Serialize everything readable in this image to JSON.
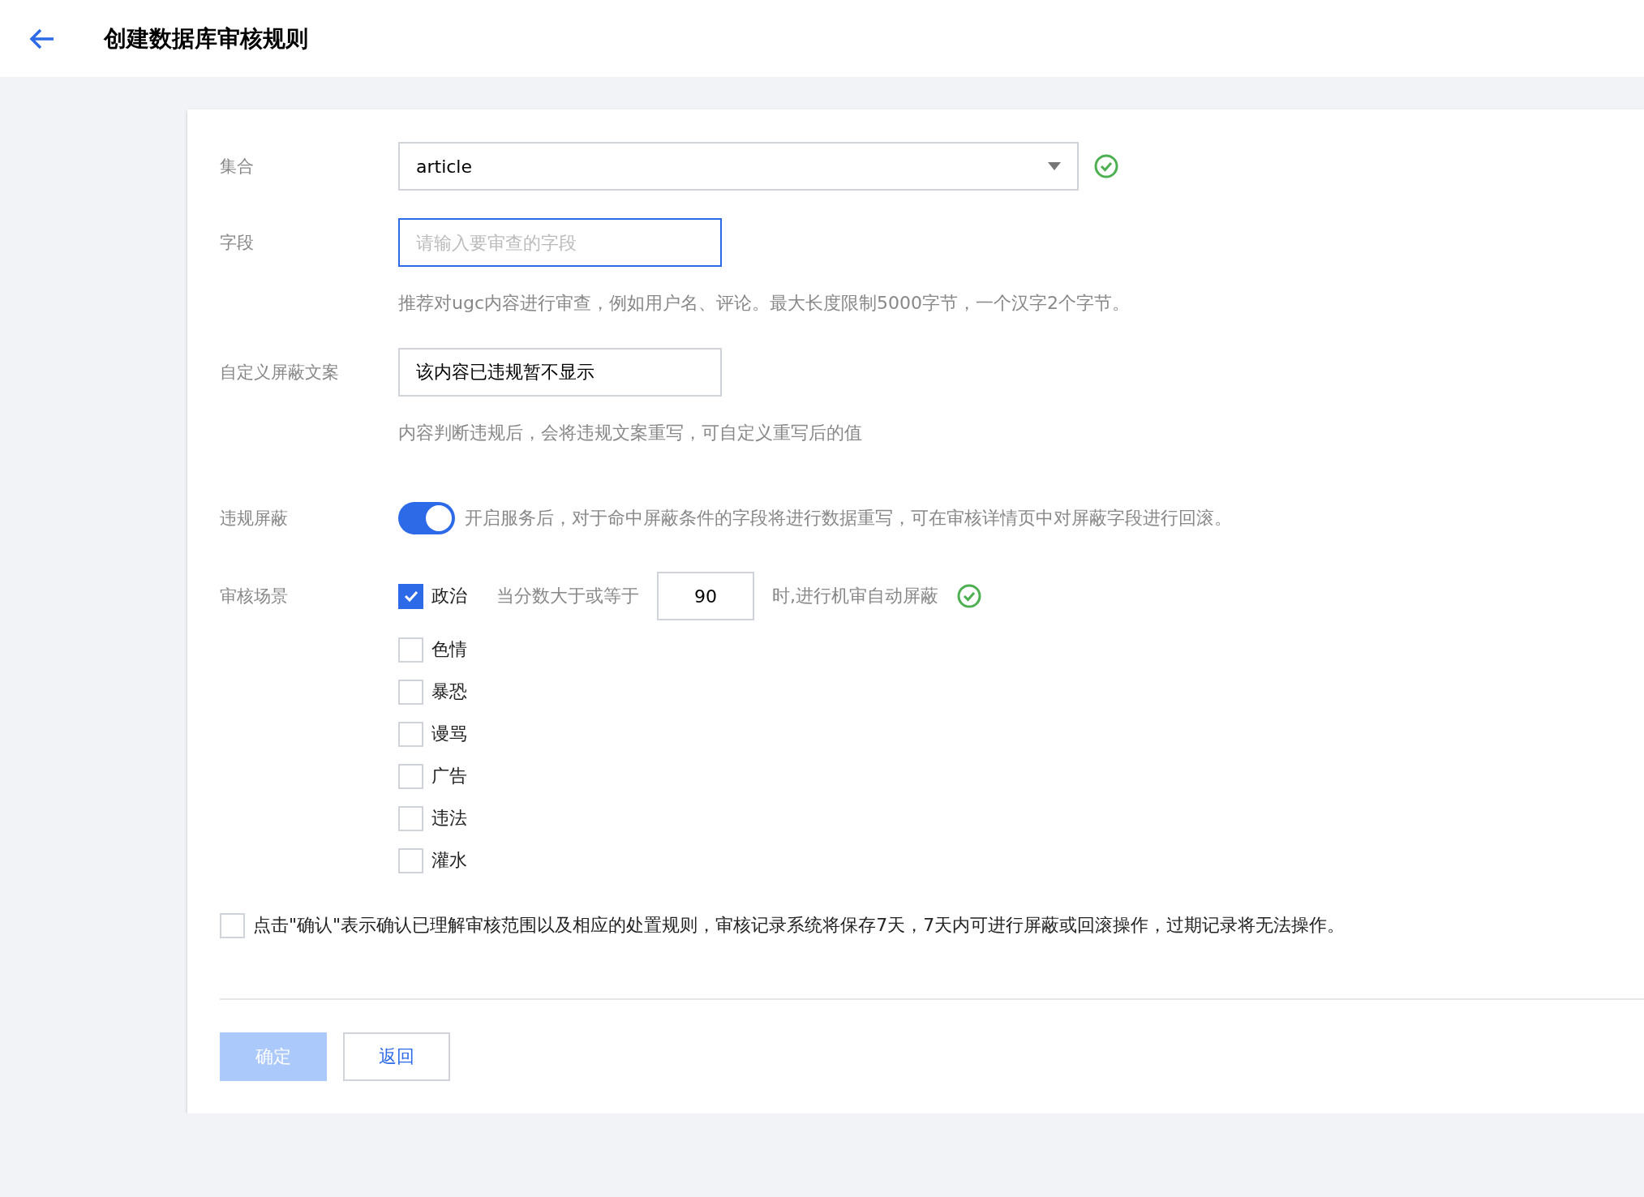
{
  "header": {
    "title": "创建数据库审核规则"
  },
  "form": {
    "collection": {
      "label": "集合",
      "value": "article"
    },
    "field": {
      "label": "字段",
      "placeholder": "请输入要审查的字段",
      "focused": true,
      "hint": "推荐对ugc内容进行审查，例如用户名、评论。最大长度限制5000字节，一个汉字2个字节。"
    },
    "mask_text": {
      "label": "自定义屏蔽文案",
      "value": "该内容已违规暂不显示",
      "hint": "内容判断违规后，会将违规文案重写，可自定义重写后的值"
    },
    "violation_mask": {
      "label": "违规屏蔽",
      "on": true,
      "description": "开启服务后，对于命中屏蔽条件的字段将进行数据重写，可在审核详情页中对屏蔽字段进行回滚。"
    },
    "scenes": {
      "label": "审核场景",
      "items": [
        {
          "label": "政治",
          "checked": true,
          "threshold_prefix": "当分数大于或等于",
          "threshold": "90",
          "threshold_suffix": "时,进行机审自动屏蔽"
        },
        {
          "label": "色情",
          "checked": false
        },
        {
          "label": "暴恐",
          "checked": false
        },
        {
          "label": "谩骂",
          "checked": false
        },
        {
          "label": "广告",
          "checked": false
        },
        {
          "label": "违法",
          "checked": false
        },
        {
          "label": "灌水",
          "checked": false
        }
      ]
    },
    "agreement": {
      "checked": false,
      "text": "点击\"确认\"表示确认已理解审核范围以及相应的处置规则，审核记录系统将保存7天，7天内可进行屏蔽或回滚操作，过期记录将无法操作。"
    }
  },
  "buttons": [
    {
      "label": "确定",
      "kind": "primary",
      "disabled": true
    },
    {
      "label": "返回",
      "kind": "secondary"
    }
  ]
}
